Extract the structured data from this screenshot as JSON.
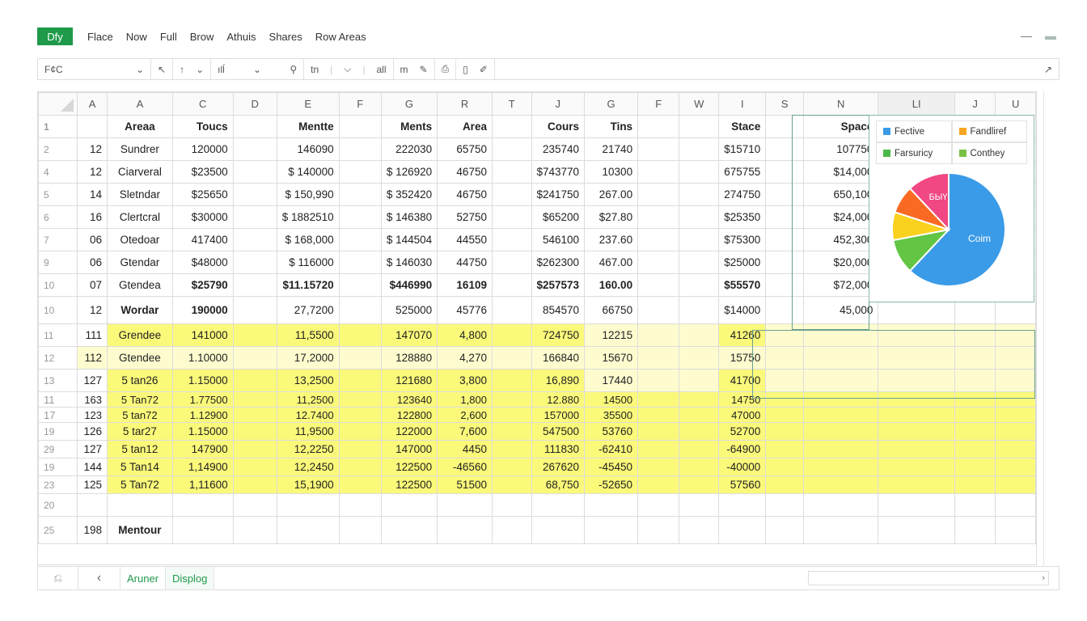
{
  "app": {
    "badge": "Dfy"
  },
  "menu": [
    "Flace",
    "Now",
    "Full",
    "Brow",
    "Athuis",
    "Shares",
    "Row Areas"
  ],
  "window": {
    "minimize": "—",
    "restore": "▬"
  },
  "toolbar": {
    "name_box": "F¢C",
    "items": [
      "⌄",
      "↖",
      "↑",
      "⌄",
      "ılĺ",
      "⌄",
      "⚲",
      "tn",
      "|",
      "⌵",
      "|",
      "all",
      "m",
      "✎",
      "⎙",
      "▯",
      "✐"
    ],
    "expand": "↗"
  },
  "columns": [
    "",
    "A",
    "A",
    "C",
    "D",
    "E",
    "F",
    "G",
    "R",
    "T",
    "J",
    "G",
    "F",
    "W",
    "I",
    "S",
    "N",
    "LI",
    "J",
    "U"
  ],
  "rows": [
    {
      "n": "1",
      "type": "hdr",
      "cells": [
        "",
        "Areaa",
        "Toucs",
        "",
        "Mentte",
        "",
        "Ments",
        "Area",
        "",
        "Cours",
        "Tins",
        "",
        "",
        "Stace",
        "",
        "Space",
        "",
        "",
        ""
      ]
    },
    {
      "n": "2",
      "cells": [
        "12",
        "Sundrer",
        "120000",
        "",
        "146090",
        "",
        "222030",
        "65750",
        "",
        "235740",
        "21740",
        "",
        "",
        "$15710",
        "",
        "107750",
        "",
        "",
        ""
      ]
    },
    {
      "n": "4",
      "cells": [
        "12",
        "Ciarveral",
        "$23500",
        "",
        "$ 140000",
        "",
        "$ 126920",
        "46750",
        "",
        "$743770",
        "10300",
        "",
        "",
        "675755",
        "",
        "$14,000",
        "",
        "",
        ""
      ]
    },
    {
      "n": "5",
      "cells": [
        "14",
        "Sletndar",
        "$25650",
        "",
        "$ 150,990",
        "",
        "$ 352420",
        "46750",
        "",
        "$241750",
        "267.00",
        "",
        "",
        "274750",
        "",
        "650,100",
        "",
        "",
        ""
      ]
    },
    {
      "n": "6",
      "cells": [
        "16",
        "Clertcral",
        "$30000",
        "",
        "$ 1882510",
        "",
        "$ 146380",
        "52750",
        "",
        "$65200",
        "$27.80",
        "",
        "",
        "$25350",
        "",
        "$24,000",
        "",
        "",
        ""
      ]
    },
    {
      "n": "7",
      "cells": [
        "06",
        "Otedoar",
        "417400",
        "",
        "$ 168,000",
        "",
        "$ 144504",
        "44550",
        "",
        "546100",
        "237.60",
        "",
        "",
        "$75300",
        "",
        "452,300",
        "",
        "",
        ""
      ]
    },
    {
      "n": "9",
      "cells": [
        "06",
        "Gtendar",
        "$48000",
        "",
        "$ 116000",
        "",
        "$ 146030",
        "44750",
        "",
        "$262300",
        "467.00",
        "",
        "",
        "$25000",
        "",
        "$20,000",
        "",
        "",
        ""
      ]
    },
    {
      "n": "10",
      "type": "bold",
      "cells": [
        "07",
        "Gtendea",
        "$25790",
        "",
        "$11.15720",
        "",
        "$446990",
        "16109",
        "",
        "$257573",
        "160.00",
        "",
        "",
        "$55570",
        "",
        "$72,000",
        "",
        "",
        ""
      ]
    },
    {
      "n": "10",
      "type": "tall",
      "cells": [
        "12",
        "Wordar",
        "190000",
        "",
        "27,7200",
        "",
        "525000",
        "45776",
        "",
        "854570",
        "66750",
        "",
        "",
        "$14000",
        "",
        "45,000",
        "",
        "",
        ""
      ]
    },
    {
      "n": "11",
      "type": "y",
      "cells": [
        "111",
        "Grendee",
        "141000",
        "",
        "11,5500",
        "",
        "147070",
        "4,800",
        "",
        "724750",
        "12215",
        "",
        "",
        "41260",
        "",
        "",
        "",
        "",
        ""
      ]
    },
    {
      "n": "12",
      "type": "yl",
      "cells": [
        "112",
        "Gtendee",
        "1.10000",
        "",
        "17,2000",
        "",
        "128880",
        "4,270",
        "",
        "166840",
        "15670",
        "",
        "",
        "15750",
        "",
        "",
        "",
        "",
        ""
      ]
    },
    {
      "n": "13",
      "type": "y",
      "cells": [
        "127",
        "5 tan26",
        "1.15000",
        "",
        "13,2500",
        "",
        "121680",
        "3,800",
        "",
        "16,890",
        "17440",
        "",
        "",
        "41700",
        "",
        "",
        "",
        "",
        ""
      ]
    },
    {
      "n": "11",
      "type": "yc",
      "cells": [
        "163",
        "5 Tan72",
        "1.77500",
        "",
        "11,2500",
        "",
        "123640",
        "1,800",
        "",
        "12.880",
        "14500",
        "",
        "",
        "14750",
        "",
        "",
        "",
        "",
        ""
      ]
    },
    {
      "n": "17",
      "type": "yc",
      "cells": [
        "123",
        "5 tan72",
        "1.12900",
        "",
        "12.7400",
        "",
        "122800",
        "2,600",
        "",
        "157000",
        "35500",
        "",
        "",
        "47000",
        "",
        "",
        "",
        "",
        ""
      ]
    },
    {
      "n": "19",
      "type": "ym",
      "cells": [
        "126",
        "5 tar27",
        "1.15000",
        "",
        "11,9500",
        "",
        "122000",
        "7,600",
        "",
        "547500",
        "53760",
        "",
        "",
        "52700",
        "",
        "",
        "",
        "",
        ""
      ]
    },
    {
      "n": "29",
      "type": "ym",
      "cells": [
        "127",
        "5 tan12",
        "147900",
        "",
        "12,2250",
        "",
        "147000",
        "4450",
        "",
        "111830",
        "-62410",
        "",
        "",
        "-64900",
        "",
        "",
        "",
        "",
        ""
      ]
    },
    {
      "n": "19",
      "type": "ym",
      "cells": [
        "144",
        "5 Tan14",
        "1,14900",
        "",
        "12,2450",
        "",
        "122500",
        "-46560",
        "",
        "267620",
        "-45450",
        "",
        "",
        "-40000",
        "",
        "",
        "",
        "",
        ""
      ]
    },
    {
      "n": "23",
      "type": "ym",
      "cells": [
        "125",
        "5 Tan72",
        "1,11600",
        "",
        "15,1900",
        "",
        "122500",
        "51500",
        "",
        "68,750",
        "-52650",
        "",
        "",
        "57560",
        "",
        "",
        "",
        "",
        ""
      ]
    },
    {
      "n": "20",
      "type": "blank",
      "cells": [
        "",
        "",
        "",
        "",
        "",
        "",
        "",
        "",
        "",
        "",
        "",
        "",
        "",
        "",
        "",
        "",
        "",
        "",
        ""
      ]
    },
    {
      "n": "25",
      "type": "tall",
      "cells": [
        "198",
        "Mentour",
        "",
        "",
        "",
        "",
        "",
        "",
        "",
        "",
        "",
        "",
        "",
        "",
        "",
        "",
        "",
        "",
        ""
      ]
    }
  ],
  "chart": {
    "legend": [
      {
        "label": "Fective",
        "color": "#3a9be8"
      },
      {
        "label": "Fandliref",
        "color": "#f5a623"
      },
      {
        "label": "Farsuricy",
        "color": "#4cb848"
      },
      {
        "label": "Conthey",
        "color": "#7ac142"
      }
    ],
    "labels": {
      "main": "Coim",
      "small": "БЫҮ"
    },
    "slices": [
      {
        "name": "Coim",
        "value": 62,
        "color": "#3a9be8"
      },
      {
        "name": "green",
        "value": 10,
        "color": "#62c544"
      },
      {
        "name": "yellow",
        "value": 8,
        "color": "#fbd11f"
      },
      {
        "name": "orange",
        "value": 8,
        "color": "#fa6a22"
      },
      {
        "name": "БЫҮ",
        "value": 12,
        "color": "#f14782"
      }
    ]
  },
  "footer": {
    "first": "⎌",
    "prev": "‹",
    "sheets": [
      "Aruner",
      "Displog"
    ],
    "next": "›"
  }
}
